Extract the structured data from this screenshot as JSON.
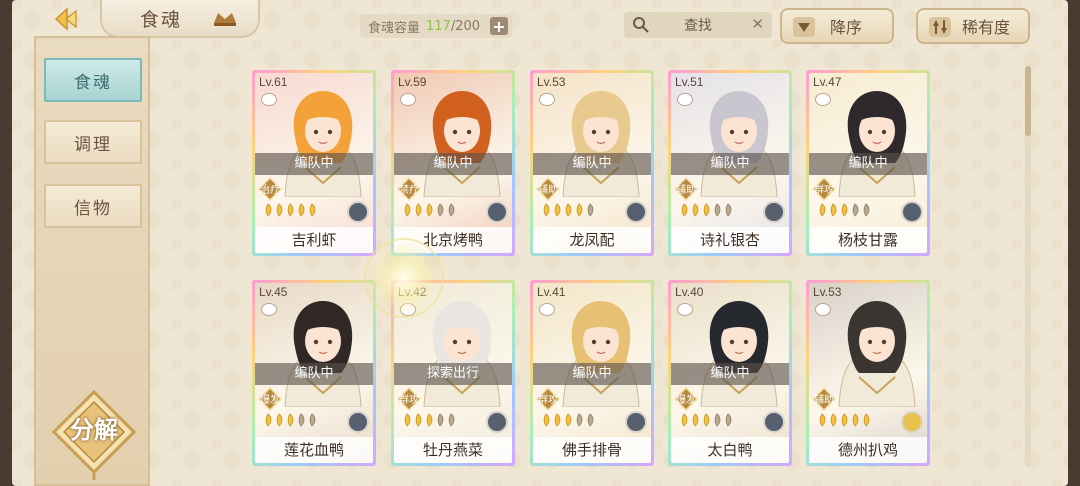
{
  "header": {
    "title": "食魂",
    "capacity_label": "食魂容量",
    "capacity_current": "117",
    "capacity_max": "/200",
    "capacity_add": "+",
    "search_label": "查找",
    "sort_desc_label": "降序",
    "sort_rarity_label": "稀有度"
  },
  "sidebar": {
    "items": [
      {
        "label": "食魂",
        "active": true
      },
      {
        "label": "调理",
        "active": false
      },
      {
        "label": "信物",
        "active": false
      }
    ],
    "decompose_label": "分解"
  },
  "cards": [
    {
      "level": "Lv.61",
      "status": "编队中",
      "role": "治疗",
      "stars_filled": 5,
      "name": "吉利虾",
      "bg": "#f7d9d2",
      "hair": "#f3a23a",
      "emblem": "dark"
    },
    {
      "level": "Lv.59",
      "status": "编队中",
      "role": "禁疗",
      "stars_filled": 3,
      "name": "北京烤鸭",
      "bg": "#f0c9b4",
      "hair": "#d2601e",
      "emblem": "dark"
    },
    {
      "level": "Lv.53",
      "status": "编队中",
      "role": "辅助",
      "stars_filled": 4,
      "name": "龙凤配",
      "bg": "#f4e2c6",
      "hair": "#e8c98e",
      "emblem": "dark"
    },
    {
      "level": "Lv.51",
      "status": "编队中",
      "role": "辅助",
      "stars_filled": 3,
      "name": "诗礼银杏",
      "bg": "#e4e2e8",
      "hair": "#c9c6cf",
      "emblem": "dark"
    },
    {
      "level": "Lv.47",
      "status": "编队中",
      "role": "群攻",
      "stars_filled": 3,
      "name": "杨枝甘露",
      "bg": "#f6ecd0",
      "hair": "#2e2a2c",
      "emblem": "dark"
    },
    {
      "level": "Lv.45",
      "status": "编队中",
      "role": "爆发",
      "stars_filled": 3,
      "name": "莲花血鸭",
      "bg": "#e7d9c6",
      "hair": "#2f2824",
      "emblem": "dark"
    },
    {
      "level": "Lv.42",
      "status": "探索出行",
      "role": "群攻",
      "stars_filled": 3,
      "name": "牡丹燕菜",
      "bg": "#f0ead8",
      "hair": "#e9e6e2",
      "emblem": "dark"
    },
    {
      "level": "Lv.41",
      "status": "编队中",
      "role": "群攻",
      "stars_filled": 3,
      "name": "佛手排骨",
      "bg": "#f2e6c8",
      "hair": "#e6c174",
      "emblem": "dark"
    },
    {
      "level": "Lv.40",
      "status": "编队中",
      "role": "爆发",
      "stars_filled": 3,
      "name": "太白鸭",
      "bg": "#eadfca",
      "hair": "#26292e",
      "emblem": "dark"
    },
    {
      "level": "Lv.53",
      "status": "",
      "role": "辅助",
      "stars_filled": 5,
      "name": "德州扒鸡",
      "bg": "#d8d2c8",
      "hair": "#3a3531",
      "emblem": "gold"
    }
  ]
}
